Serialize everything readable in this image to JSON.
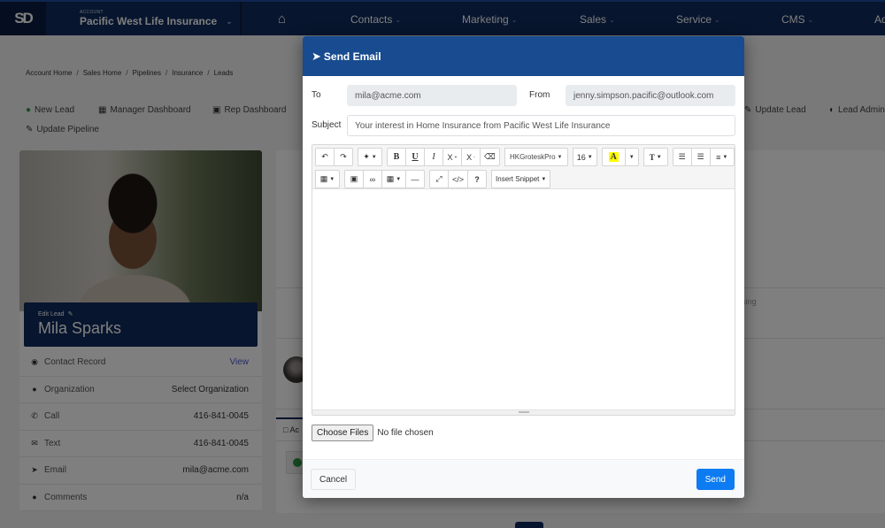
{
  "topnav": {
    "logo": "SD",
    "account_label": "ACCOUNT",
    "account_name": "Pacific West Life Insurance",
    "home_icon": "home-icon",
    "items": [
      {
        "label": "Contacts"
      },
      {
        "label": "Marketing"
      },
      {
        "label": "Sales"
      },
      {
        "label": "Service"
      },
      {
        "label": "CMS"
      },
      {
        "label": "Ad"
      }
    ]
  },
  "breadcrumb": [
    "Account Home",
    "Sales Home",
    "Pipelines",
    "Insurance",
    "Leads"
  ],
  "breadcrumb_sep": "/",
  "actions": {
    "new_lead": "New Lead",
    "manager_dashboard": "Manager Dashboard",
    "rep_dashboard": "Rep Dashboard",
    "update_pipeline": "Update Pipeline",
    "update_lead": "Update Lead",
    "lead_admin": "Lead Admin"
  },
  "lead": {
    "edit_label": "Edit Lead",
    "name": "Mila Sparks",
    "rows": [
      {
        "icon": "eye-icon",
        "label": "Contact Record",
        "value": "View",
        "link": true
      },
      {
        "icon": "info-icon",
        "label": "Organization",
        "value": "Select Organization",
        "link": false
      },
      {
        "icon": "phone-icon",
        "label": "Call",
        "value": "416-841-0045",
        "link": false
      },
      {
        "icon": "comments-icon",
        "label": "Text",
        "value": "416-841-0045",
        "link": false
      },
      {
        "icon": "paper-plane-icon",
        "label": "Email",
        "value": "mila@acme.com",
        "link": false
      },
      {
        "icon": "info-icon",
        "label": "Comments",
        "value": "n/a",
        "link": false
      }
    ]
  },
  "background": {
    "tab_partial": "Ac",
    "closing_partial": "sing"
  },
  "modal": {
    "title": "Send Email",
    "to_label": "To",
    "to_value": "mila@acme.com",
    "from_label": "From",
    "from_value": "jenny.simpson.pacific@outlook.com",
    "subject_label": "Subject",
    "subject_value": "Your interest in Home Insurance from Pacific West Life Insurance",
    "toolbar": {
      "font_name": "HKGroteskPro",
      "font_size": "16",
      "bold": "B",
      "underline": "U",
      "italic": "I",
      "superscript": "X",
      "subscript": "X",
      "highlight": "A",
      "text_style": "T",
      "help": "?",
      "code": "</>",
      "insert_snippet": "Insert Snippet"
    },
    "body_value": "",
    "choose_files_label": "Choose Files",
    "file_status": "No file chosen",
    "cancel_label": "Cancel",
    "send_label": "Send"
  },
  "colors": {
    "nav_bg": "#0e2b5c",
    "modal_header": "#184b8f",
    "send_button": "#0d7bf2",
    "new_lead_green": "#2e9b45"
  }
}
